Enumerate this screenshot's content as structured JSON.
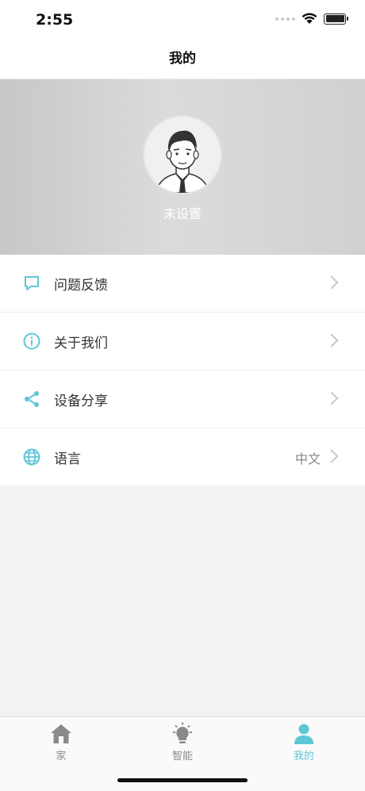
{
  "status_bar": {
    "time": "2:55"
  },
  "header": {
    "title": "我的"
  },
  "profile": {
    "avatar_icon": "user-avatar-icon",
    "name": "未设置"
  },
  "menu": {
    "items": [
      {
        "label": "问题反馈",
        "icon": "message-icon",
        "value": ""
      },
      {
        "label": "关于我们",
        "icon": "info-icon",
        "value": ""
      },
      {
        "label": "设备分享",
        "icon": "share-icon",
        "value": ""
      },
      {
        "label": "语言",
        "icon": "globe-icon",
        "value": "中文"
      }
    ]
  },
  "tab_bar": {
    "tabs": [
      {
        "label": "家",
        "icon": "home-icon",
        "active": false
      },
      {
        "label": "智能",
        "icon": "lightbulb-icon",
        "active": false
      },
      {
        "label": "我的",
        "icon": "person-icon",
        "active": true
      }
    ]
  },
  "colors": {
    "accent": "#5fc6d6",
    "inactive": "#8a8a8a",
    "background": "#f2f2f2"
  }
}
